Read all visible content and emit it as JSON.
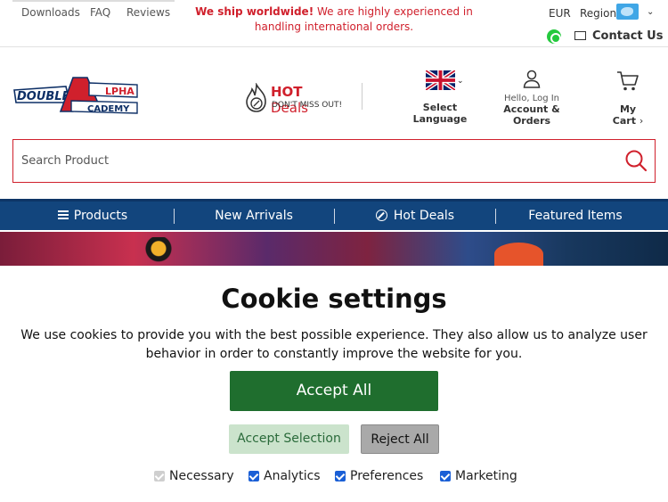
{
  "top_links": [
    "Downloads",
    "FAQ",
    "Reviews"
  ],
  "shipping": {
    "bold": "We ship worldwide!",
    "rest": " We are highly experienced in handling international orders."
  },
  "currency": "EUR",
  "region_label": "Region",
  "contact_label": "Contact Us",
  "hot_deals": {
    "hot": "HOT",
    "deals": " Deals",
    "sub": "DON'T MISS OUT!"
  },
  "language": {
    "line1": "Select",
    "line2": "Language"
  },
  "account": {
    "hello": "Hello, Log In",
    "line1": "Account &",
    "line2": "Orders"
  },
  "cart": {
    "line1": "My",
    "line2": "Cart"
  },
  "search": {
    "placeholder": "Search Product"
  },
  "nav": {
    "products": "Products",
    "new_arrivals": "New Arrivals",
    "hot_deals": "Hot Deals",
    "featured": "Featured Items"
  },
  "cookie": {
    "title": "Cookie settings",
    "text": "We use cookies to provide you with the best possible experience. They also allow us to analyze user behavior in order to constantly improve the website for you.",
    "accept_all": "Accept All",
    "accept_selection": "Accept Selection",
    "reject_all": "Reject All",
    "options": [
      {
        "label": "Necessary",
        "checked": true,
        "disabled": true
      },
      {
        "label": "Analytics",
        "checked": true,
        "disabled": false
      },
      {
        "label": "Preferences",
        "checked": true,
        "disabled": false
      },
      {
        "label": "Marketing",
        "checked": true,
        "disabled": false
      }
    ]
  },
  "colors": {
    "brand_red": "#d0202c",
    "nav_blue": "#12457d",
    "accept_green": "#1f6e2e"
  },
  "icons": [
    "whatsapp-icon",
    "mail-icon",
    "region-flag-icon",
    "uk-flag-icon",
    "user-icon",
    "cart-icon",
    "search-icon",
    "menu-icon",
    "percent-badge-icon",
    "flame-icon"
  ]
}
